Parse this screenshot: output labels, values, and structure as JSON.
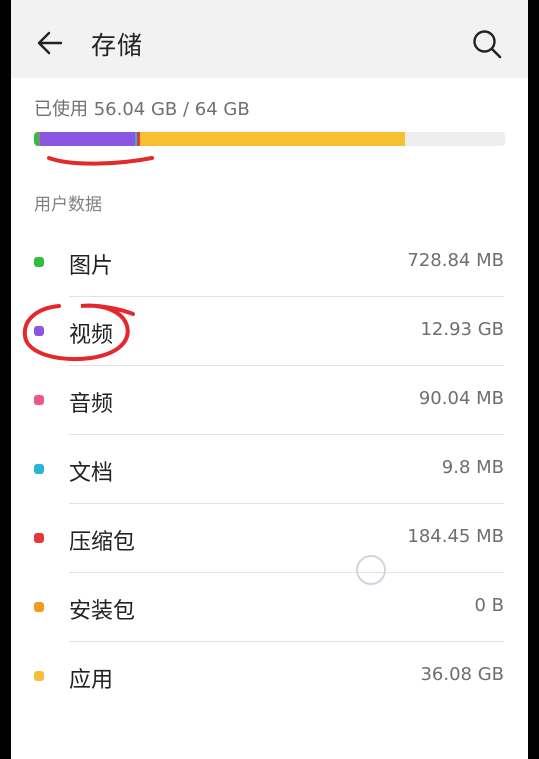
{
  "header": {
    "title": "存储",
    "back_icon": "back-arrow-icon",
    "search_icon": "search-icon"
  },
  "storage": {
    "used_text": "已使用 56.04 GB / 64 GB",
    "bar_segments": [
      {
        "name": "图片",
        "fraction": 0.0114,
        "color": "#2fbf3a"
      },
      {
        "name": "音频",
        "fraction": 0.0014,
        "color": "#e8578f"
      },
      {
        "name": "视频",
        "fraction": 0.202,
        "color": "#8a56e2"
      },
      {
        "name": "文档",
        "fraction": 0.0035,
        "color": "#29b6d6"
      },
      {
        "name": "压缩包",
        "fraction": 0.006,
        "color": "#e5383b"
      },
      {
        "name": "应用",
        "fraction": 0.564,
        "color": "#f7c033"
      }
    ]
  },
  "section_title": "用户数据",
  "items": [
    {
      "label": "图片",
      "size": "728.84 MB",
      "color": "#2fbf3a"
    },
    {
      "label": "视频",
      "size": "12.93 GB",
      "color": "#8a56e2"
    },
    {
      "label": "音频",
      "size": "90.04 MB",
      "color": "#e8578f"
    },
    {
      "label": "文档",
      "size": "9.8 MB",
      "color": "#29b6d6"
    },
    {
      "label": "压缩包",
      "size": "184.45 MB",
      "color": "#e5383b"
    },
    {
      "label": "安装包",
      "size": "0 B",
      "color": "#f39a1f"
    },
    {
      "label": "应用",
      "size": "36.08 GB",
      "color": "#f7c033"
    }
  ],
  "annotations": {
    "color": "#e4292c"
  }
}
